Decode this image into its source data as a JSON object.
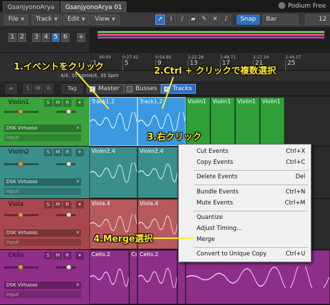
{
  "titlebar": {
    "tabs": [
      "GsanjyonoArya",
      "GsanjyonoArya 01"
    ],
    "brand": "Podium Free"
  },
  "menubar": {
    "menus": [
      "File",
      "Track",
      "Edit",
      "View"
    ],
    "tools": [
      "arrow-tool-icon",
      "range-tool-icon",
      "split-tool-icon",
      "eraser-tool-icon",
      "paint-tool-icon",
      "mute-tool-icon",
      "listen-tool-icon"
    ],
    "snap_label": "Snap",
    "quantize_value": "Bar",
    "right_value": "12"
  },
  "overview": {
    "scene_numbers": [
      "1",
      "2",
      "3",
      "4",
      "5",
      "6",
      "+"
    ],
    "active_scene": "5",
    "bar_colors": [
      "#7ab95a",
      "#c65c8e",
      "#a54aa3"
    ]
  },
  "ruler": {
    "times": [
      "00:00",
      "0:27.42",
      "0:54.85",
      "1:22.28",
      "1:49.71",
      "2:17.14",
      "2:44.57"
    ],
    "bars": [
      "1",
      "5",
      "9",
      "13",
      "17",
      "21",
      "25"
    ],
    "tempo": [
      "4/4, 35 bpm",
      "4/4, 35 bpm"
    ]
  },
  "header": {
    "buttons": [
      "S",
      "M",
      "R"
    ],
    "tag_label": "Tag",
    "folders": [
      "Master",
      "Busses",
      "Tracks"
    ]
  },
  "tracks": [
    {
      "name": "Violin1",
      "instrument": "DSK Virtuoso",
      "input": "Input",
      "color": "#3aa33a",
      "events": [
        "Track1.2",
        "Track1.2",
        "Violin1",
        "Violin1",
        "Violin1",
        "Violin1"
      ]
    },
    {
      "name": "Violin2",
      "instrument": "DSK Virtuoso",
      "input": "Input",
      "color": "#3a8f8a",
      "events": [
        "Violin2.4",
        "Violin2.4"
      ]
    },
    {
      "name": "Viola",
      "instrument": "DSK Virtuoso",
      "input": "Input",
      "color": "#a8484e",
      "events": [
        "Viola.4",
        "Viola.4"
      ]
    },
    {
      "name": "Cello",
      "instrument": "DSK Virtuoso",
      "input": "Input",
      "color": "#8f2f8a",
      "events": [
        "Cello.2",
        "Ce",
        "Cello.2",
        "Ce"
      ]
    }
  ],
  "context_menu": {
    "items": [
      {
        "label": "Cut Events",
        "shortcut": "Ctrl+X"
      },
      {
        "label": "Copy Events",
        "shortcut": "Ctrl+C"
      },
      {
        "label": "Delete Events",
        "shortcut": "Del"
      },
      {
        "label": "Bundle Events",
        "shortcut": "Ctrl+N"
      },
      {
        "label": "Mute Events",
        "shortcut": "Ctrl+M"
      },
      {
        "label": "Quantize",
        "shortcut": ""
      },
      {
        "label": "Adjust Timing...",
        "shortcut": ""
      },
      {
        "label": "Merge",
        "shortcut": ""
      },
      {
        "label": "Convert to Unique Copy",
        "shortcut": "Ctrl+U"
      }
    ]
  },
  "annotations": {
    "step1": "1.イベントをクリック",
    "step2": "2.Ctrl + クリックで複数選択",
    "step3": "3.右クリック",
    "step4": "4.Merge選択"
  },
  "colors": {
    "accent": "#2d6fc0",
    "annotation": "#ffe92e",
    "selected_event": "#3a98e0"
  }
}
